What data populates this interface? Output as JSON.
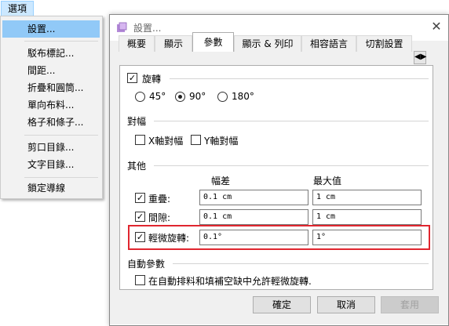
{
  "menu": {
    "title": "選項",
    "items": [
      "設置...",
      "駁布標記...",
      "間距...",
      "折疊和圓筒...",
      "單向布料...",
      "格子和條子...",
      "剪口目錄...",
      "文字目錄...",
      "鎖定導線"
    ]
  },
  "dialog": {
    "title": "設置...",
    "close": "✕",
    "tabs": [
      "概要",
      "顯示",
      "參數",
      "顯示 & 列印",
      "相容語言",
      "切割設置"
    ],
    "tab_scroll": "◀▶",
    "rotation": {
      "label": "旋轉",
      "checked": true,
      "options": [
        "45°",
        "90°",
        "180°"
      ],
      "selected": "90°"
    },
    "align": {
      "title": "對幅",
      "x_label": "X軸對幅",
      "y_label": "Y軸對幅"
    },
    "other": {
      "title": "其他",
      "col_tolerance": "幅差",
      "col_max": "最大值",
      "rows": [
        {
          "label": "重疊:",
          "tolerance": "0.1 cm",
          "max": "1 cm",
          "checked": true
        },
        {
          "label": "間隙:",
          "tolerance": "0.1 cm",
          "max": "1 cm",
          "checked": true
        },
        {
          "label": "輕微旋轉:",
          "tolerance": "0.1°",
          "max": "1°",
          "checked": true
        }
      ]
    },
    "auto": {
      "title": "自動參數",
      "option": "在自動排料和填補空缺中允許輕微旋轉."
    },
    "buttons": {
      "ok": "確定",
      "cancel": "取消",
      "apply": "套用"
    }
  },
  "colors": {
    "highlight": "#e0262f",
    "menu_selected": "#91c9f7"
  }
}
